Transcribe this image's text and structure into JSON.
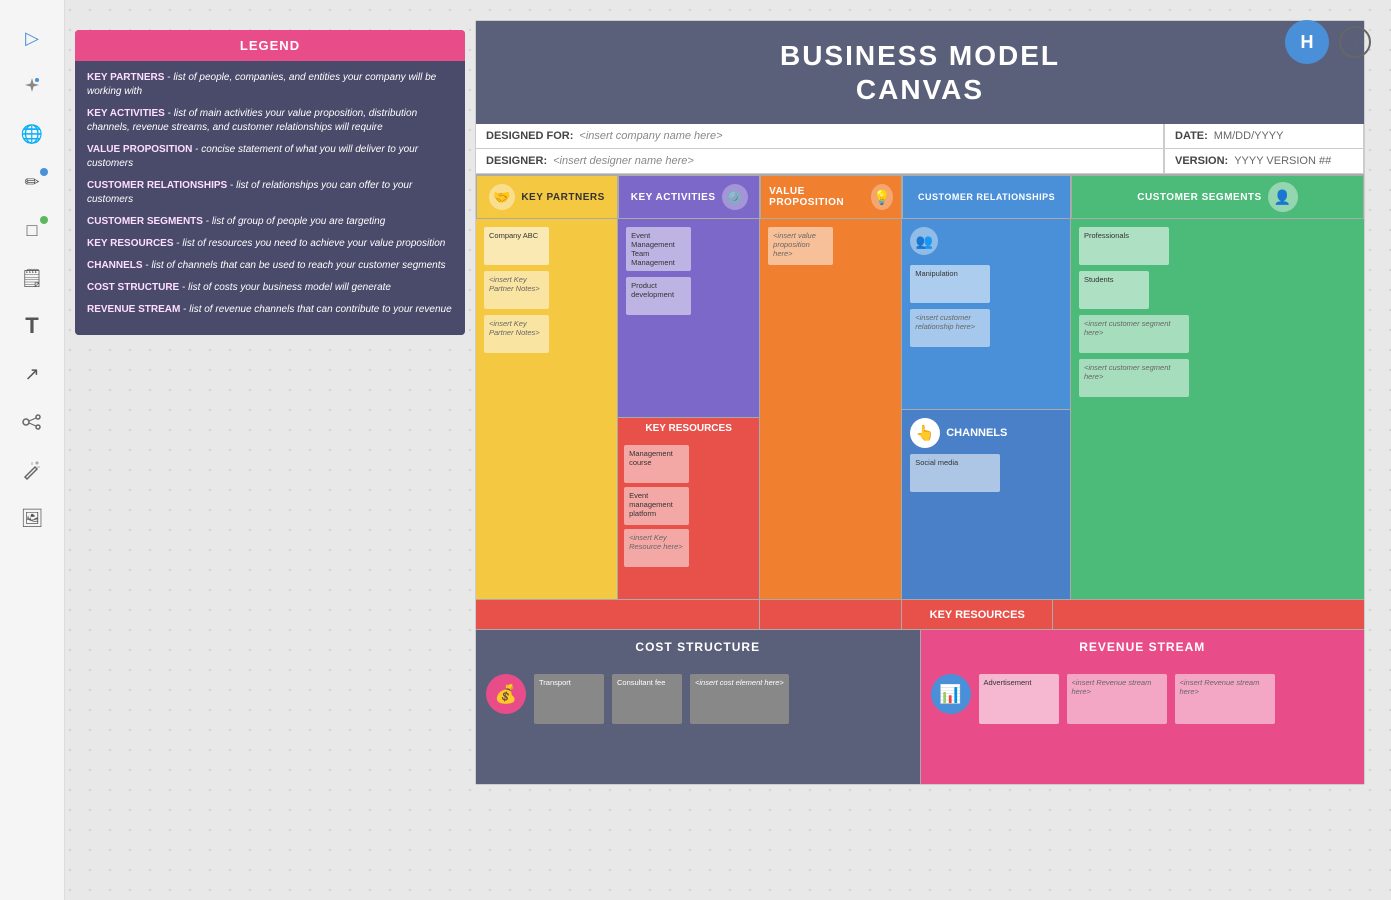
{
  "toolbar": {
    "icons": [
      {
        "name": "cursor-icon",
        "symbol": "▷",
        "active": true
      },
      {
        "name": "ai-icon",
        "symbol": "✦",
        "active": false
      },
      {
        "name": "globe-icon",
        "symbol": "🌐",
        "active": false
      },
      {
        "name": "pencil-icon",
        "symbol": "✏️",
        "active": false,
        "dot": "blue"
      },
      {
        "name": "rectangle-icon",
        "symbol": "□",
        "active": false,
        "dot": "green"
      },
      {
        "name": "sticky-icon",
        "symbol": "🗒",
        "active": false
      },
      {
        "name": "text-icon",
        "symbol": "T",
        "active": false
      },
      {
        "name": "arrow-icon",
        "symbol": "↗",
        "active": false
      },
      {
        "name": "connect-icon",
        "symbol": "⊙",
        "active": false
      },
      {
        "name": "star-icon",
        "symbol": "✦",
        "active": false
      },
      {
        "name": "image-icon",
        "symbol": "🖼",
        "active": false
      }
    ]
  },
  "legend": {
    "header": "LEGEND",
    "items": [
      {
        "key": "KEY PARTNERS",
        "desc": "list of people, companies, and entities your company will be working with"
      },
      {
        "key": "KEY ACTIVITIES",
        "desc": "list of main activities your value proposition, distribution channels, revenue streams, and customer relationships will require"
      },
      {
        "key": "VALUE PROPOSITION",
        "desc": "concise statement of what you will deliver to your customers"
      },
      {
        "key": "CUSTOMER RELATIONSHIPS",
        "desc": "list of relationships you can offer to your customers"
      },
      {
        "key": "CUSTOMER SEGMENTS",
        "desc": "list of group of people you are targeting"
      },
      {
        "key": "KEY RESOURCES",
        "desc": "list of resources you need to achieve your value proposition"
      },
      {
        "key": "CHANNELS",
        "desc": "list of channels that can be used to reach your customer segments"
      },
      {
        "key": "COST STRUCTURE",
        "desc": "list of costs your business model will generate"
      },
      {
        "key": "REVENUE STREAM",
        "desc": "list of revenue channels that can contribute to your revenue"
      }
    ]
  },
  "header": {
    "avatar": "H",
    "info": "ⓘ"
  },
  "canvas": {
    "title": "BUSINESS MODEL\nCANVAS",
    "form": {
      "designed_for_label": "DESIGNED FOR:",
      "designed_for_value": "<insert company name here>",
      "designer_label": "DESIGNER:",
      "designer_value": "<insert designer name here>",
      "date_label": "DATE:",
      "date_value": "MM/DD/YYYY",
      "version_label": "VERSION:",
      "version_value": "YYYY VERSION ##"
    },
    "sections": {
      "key_partners": {
        "label": "KEY PARTNERS",
        "notes": [
          "Company ABC",
          "<insert Key Partner Notes>",
          "<insert Key Partner Notes>"
        ]
      },
      "key_activities": {
        "label": "KEY ACTIVITIES",
        "notes": [
          "Event Management Team Management",
          "Product development"
        ]
      },
      "value_proposition": {
        "label": "VALUE PROPOSITION",
        "notes": [
          "<insert value proposition here>"
        ]
      },
      "customer_relationships": {
        "label": "CUSTOMER RELATIONSHIPS",
        "notes": [
          "Manipulation",
          "<insert customer relationship here>"
        ]
      },
      "customer_segments": {
        "label": "CUSTOMER SEGMENTS",
        "notes": [
          "Professionals",
          "Students",
          "<insert customer segment here>",
          "<insert customer segment here>"
        ]
      },
      "key_resources": {
        "label": "KEY RESOURCES",
        "notes": [
          "Management course",
          "Event management platform",
          "<insert Key Resource here>"
        ]
      },
      "channels": {
        "label": "CHANNELS",
        "notes": [
          "Social media"
        ]
      },
      "cost_structure": {
        "label": "COST STRUCTURE",
        "notes": [
          "Transport",
          "Consultant fee",
          "<insert cost element here>"
        ]
      },
      "revenue_stream": {
        "label": "REVENUE STREAM",
        "notes": [
          "Advertisement",
          "<insert Revenue stream here>",
          "<insert Revenue stream here>"
        ]
      }
    }
  }
}
